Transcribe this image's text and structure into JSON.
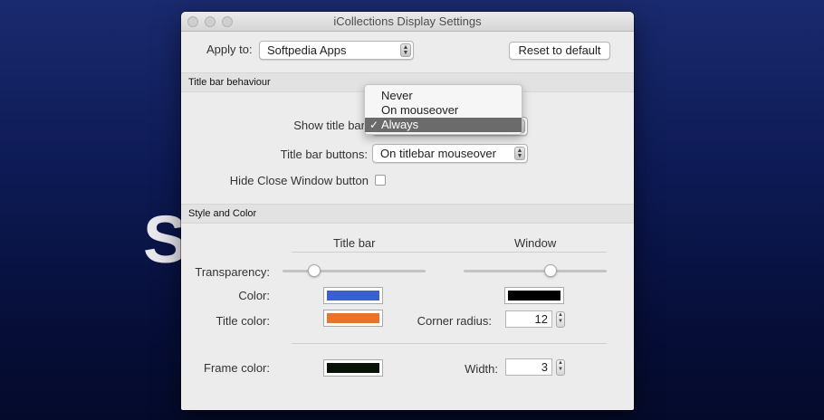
{
  "background": {
    "letter": "S"
  },
  "window": {
    "title": "iCollections Display Settings"
  },
  "toolbar": {
    "apply_label": "Apply to:",
    "apply_value": "Softpedia Apps",
    "reset_label": "Reset to default"
  },
  "titlebar_section": {
    "header": "Title bar behaviour",
    "show_title_bar_label": "Show title bar",
    "show_title_bar_menu": {
      "options": [
        "Never",
        "On mouseover",
        "Always"
      ],
      "selected": "Always"
    },
    "title_bar_buttons_label": "Title bar buttons:",
    "title_bar_buttons_value": "On titlebar mouseover",
    "hide_close_label": "Hide Close Window button",
    "hide_close_checked": false
  },
  "style_section": {
    "header": "Style and Color",
    "col_title_bar": "Title bar",
    "col_window": "Window",
    "transparency_label": "Transparency:",
    "transparency_titlebar": 0.22,
    "transparency_window": 0.61,
    "color_label": "Color:",
    "color_titlebar": "#3c5fd0",
    "color_window": "#000000",
    "title_color_label": "Title color:",
    "title_color_titlebar": "#e8732a",
    "corner_radius_label": "Corner radius:",
    "corner_radius_value": "12",
    "frame_color_label": "Frame color:",
    "frame_color_titlebar": "#071208",
    "width_label": "Width:",
    "width_value": "3"
  }
}
